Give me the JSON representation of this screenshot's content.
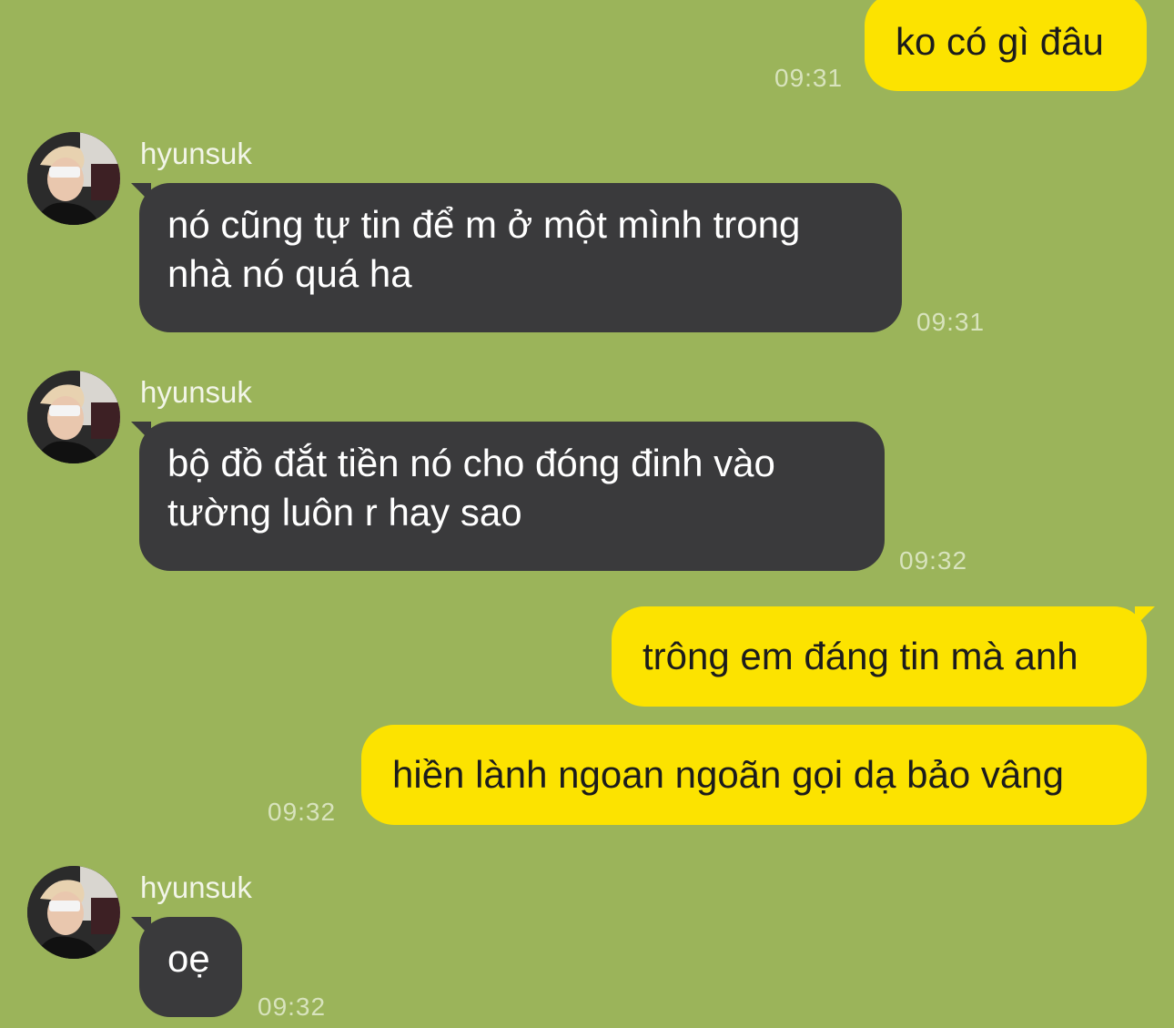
{
  "messages": [
    {
      "side": "out",
      "text": "ko có gì đâu",
      "time": "09:31"
    },
    {
      "side": "in",
      "sender": "hyunsuk",
      "text_lines": [
        "nó cũng tự tin để m ở một mình trong",
        "nhà nó quá ha"
      ],
      "time": "09:31"
    },
    {
      "side": "in",
      "sender": "hyunsuk",
      "text_lines": [
        "bộ đồ đắt tiền nó cho đóng đinh vào",
        "tường luôn r hay sao"
      ],
      "time": "09:32"
    },
    {
      "side": "out",
      "text": "trông em đáng tin mà anh"
    },
    {
      "side": "out",
      "text": "hiền lành ngoan ngoãn gọi dạ bảo vâng",
      "time": "09:32"
    },
    {
      "side": "in",
      "sender": "hyunsuk",
      "text_lines": [
        "oẹ"
      ],
      "time": "09:32"
    }
  ],
  "colors": {
    "background": "#9bb45a",
    "incoming_bubble": "#3a3a3c",
    "outgoing_bubble": "#fce300"
  },
  "icons": {
    "avatar": "profile-photo-avatar-icon"
  }
}
